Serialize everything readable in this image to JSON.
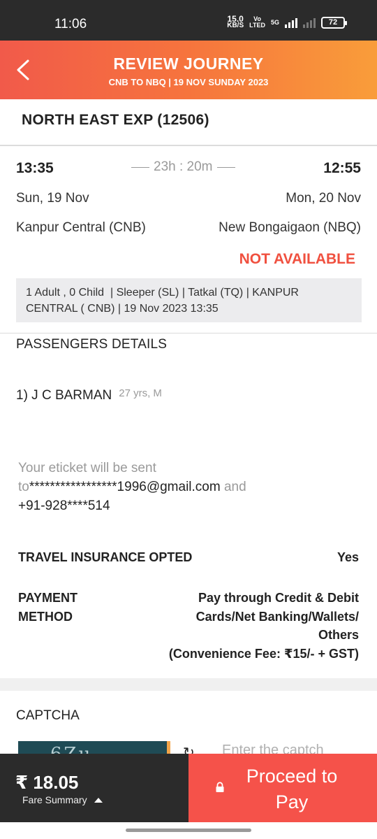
{
  "status_bar": {
    "time": "11:06",
    "net_speed_value": "15.0",
    "net_speed_unit": "KB/S",
    "volte_top": "Vo",
    "volte_bottom": "LTED",
    "network_type": "5G",
    "battery_level": "72"
  },
  "header": {
    "title": "REVIEW JOURNEY",
    "subtitle": "CNB TO NBQ | 19 NOV SUNDAY 2023",
    "back_icon": "chevron-left-icon",
    "gradient_colors": [
      "#f15a4a",
      "#f99d3a"
    ]
  },
  "journey": {
    "train_name": "NORTH EAST EXP (12506)",
    "departure_time": "13:35",
    "arrival_time": "12:55",
    "duration": "23h : 20m",
    "departure_date": "Sun, 19 Nov",
    "arrival_date": "Mon, 20 Nov",
    "from_station": "Kanpur Central (CNB)",
    "to_station": "New Bongaigaon (NBQ)",
    "availability": "NOT AVAILABLE",
    "availability_color": "#f0503f",
    "info_line1": "1 Adult , 0 Child  | Sleeper (SL) | Tatkal (TQ) | KANPUR",
    "info_line2": "CENTRAL ( CNB) | 19 Nov 2023 13:35"
  },
  "passengers": {
    "title": "PASSENGERS DETAILS",
    "items": [
      {
        "name": "1) J C BARMAN",
        "meta": "27 yrs, M"
      }
    ]
  },
  "eticket": {
    "line1": "Your eticket will be sent",
    "to_word": "to",
    "email": "*****************1996@gmail.com",
    "and_word": "and",
    "phone": "+91-928****514"
  },
  "insurance": {
    "label": "TRAVEL INSURANCE OPTED",
    "value": "Yes"
  },
  "payment": {
    "label_line1": "PAYMENT",
    "label_line2": "METHOD",
    "value_line1": "Pay through Credit & Debit",
    "value_line2": "Cards/Net Banking/Wallets/",
    "value_line3": "Others",
    "value_line4": "(Convenience Fee: ₹15/- + GST)"
  },
  "captcha": {
    "title": "CAPTCHA",
    "image_text": "6Zu",
    "refresh_icon": "refresh-icon",
    "input_placeholder": "Enter the captch"
  },
  "bottom_bar": {
    "fare": "₹ 18.05",
    "fare_summary_label": "Fare Summary",
    "proceed_line1": "Proceed to",
    "proceed_line2": "Pay",
    "proceed_color": "#f5524a",
    "lock_icon": "lock-icon"
  }
}
